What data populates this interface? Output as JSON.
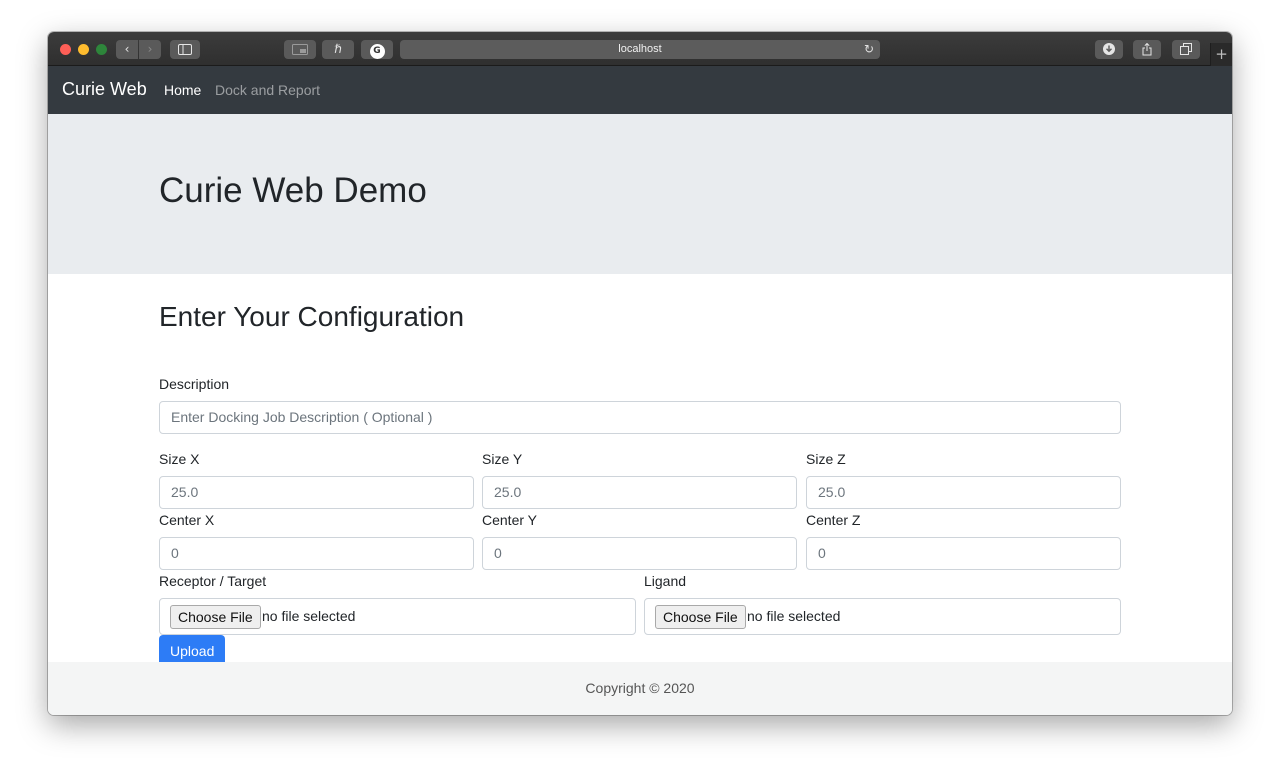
{
  "browser": {
    "url": "localhost",
    "icons": {
      "back": "chevron-left-icon",
      "forward": "chevron-right-icon",
      "sidebar": "sidebar-icon",
      "reload": "reload-icon",
      "download": "download-icon",
      "share": "share-icon",
      "tabs": "tabs-icon",
      "new_tab": "plus-icon"
    },
    "ext3_label": "G"
  },
  "navbar": {
    "brand": "Curie Web",
    "links": [
      {
        "label": "Home"
      },
      {
        "label": "Dock and Report"
      }
    ]
  },
  "jumbotron": {
    "title": "Curie Web Demo"
  },
  "form": {
    "title": "Enter Your Configuration",
    "description": {
      "label": "Description",
      "placeholder": "Enter Docking Job Description ( Optional )"
    },
    "size_x": {
      "label": "Size X",
      "placeholder": "25.0"
    },
    "size_y": {
      "label": "Size Y",
      "placeholder": "25.0"
    },
    "size_z": {
      "label": "Size Z",
      "placeholder": "25.0"
    },
    "center_x": {
      "label": "Center X",
      "placeholder": "0"
    },
    "center_y": {
      "label": "Center Y",
      "placeholder": "0"
    },
    "center_z": {
      "label": "Center Z",
      "placeholder": "0"
    },
    "receptor": {
      "label": "Receptor / Target",
      "button": "Choose File",
      "status": "no file selected"
    },
    "ligand": {
      "label": "Ligand",
      "button": "Choose File",
      "status": "no file selected"
    },
    "upload_label": "Upload"
  },
  "footer": {
    "text": "Copyright © 2020"
  },
  "colors": {
    "navbar_bg": "#343a40",
    "jumbotron_bg": "#e9ecef",
    "primary": "#2d7cf6",
    "footer_bg": "#f4f5f5"
  }
}
